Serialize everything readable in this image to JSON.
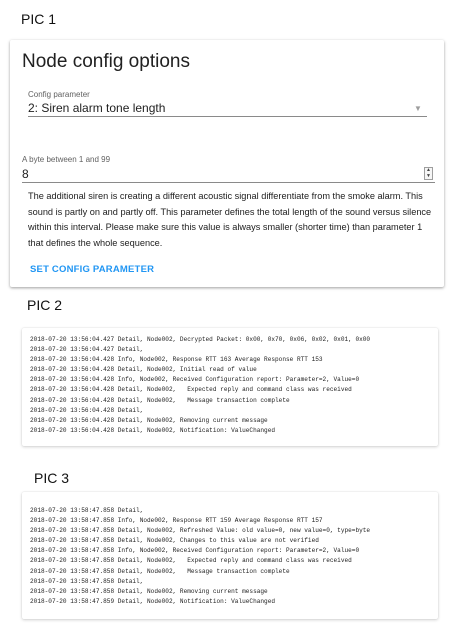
{
  "pic1": {
    "label": "PIC 1"
  },
  "pic2": {
    "label": "PIC 2"
  },
  "pic3": {
    "label": "PIC 3"
  },
  "card": {
    "title": "Node config options",
    "select_label": "Config parameter",
    "select_value": "2: Siren alarm tone length",
    "number_label": "A byte between 1 and 99",
    "number_value": "8",
    "description": "The additional siren is creating a different acoustic signal differentiate from the smoke alarm. This sound is partly on and partly off. This parameter defines the total length of the sound versus silence within this interval. Please make sure this value is always smaller (shorter time) than parameter 1 that defines the whole sequence.",
    "button_label": "SET CONFIG PARAMETER",
    "accent_color": "#2196f3"
  },
  "log1": {
    "lines": [
      "2018-07-20 13:56:04.427 Detail, Node002, Decrypted Packet: 0x00, 0x70, 0x06, 0x02, 0x01, 0x00",
      "2018-07-20 13:56:04.427 Detail,",
      "2018-07-20 13:56:04.428 Info, Node002, Response RTT 163 Average Response RTT 153",
      "2018-07-20 13:56:04.428 Detail, Node002, Initial read of value",
      "2018-07-20 13:56:04.428 Info, Node002, Received Configuration report: Parameter=2, Value=0",
      "2018-07-20 13:56:04.428 Detail, Node002,   Expected reply and command class was received",
      "2018-07-20 13:56:04.428 Detail, Node002,   Message transaction complete",
      "2018-07-20 13:56:04.428 Detail,",
      "2018-07-20 13:56:04.428 Detail, Node002, Removing current message",
      "2018-07-20 13:56:04.428 Detail, Node002, Notification: ValueChanged"
    ]
  },
  "log2": {
    "lines": [
      "2018-07-20 13:58:47.858 Detail,",
      "2018-07-20 13:58:47.858 Info, Node002, Response RTT 159 Average Response RTT 157",
      "2018-07-20 13:58:47.858 Detail, Node002, Refreshed Value: old value=0, new value=0, type=byte",
      "2018-07-20 13:58:47.858 Detail, Node002, Changes to this value are not verified",
      "2018-07-20 13:58:47.858 Info, Node002, Received Configuration report: Parameter=2, Value=0",
      "2018-07-20 13:58:47.858 Detail, Node002,   Expected reply and command class was received",
      "2018-07-20 13:58:47.858 Detail, Node002,   Message transaction complete",
      "2018-07-20 13:58:47.858 Detail,",
      "2018-07-20 13:58:47.858 Detail, Node002, Removing current message",
      "2018-07-20 13:58:47.859 Detail, Node002, Notification: ValueChanged"
    ]
  }
}
